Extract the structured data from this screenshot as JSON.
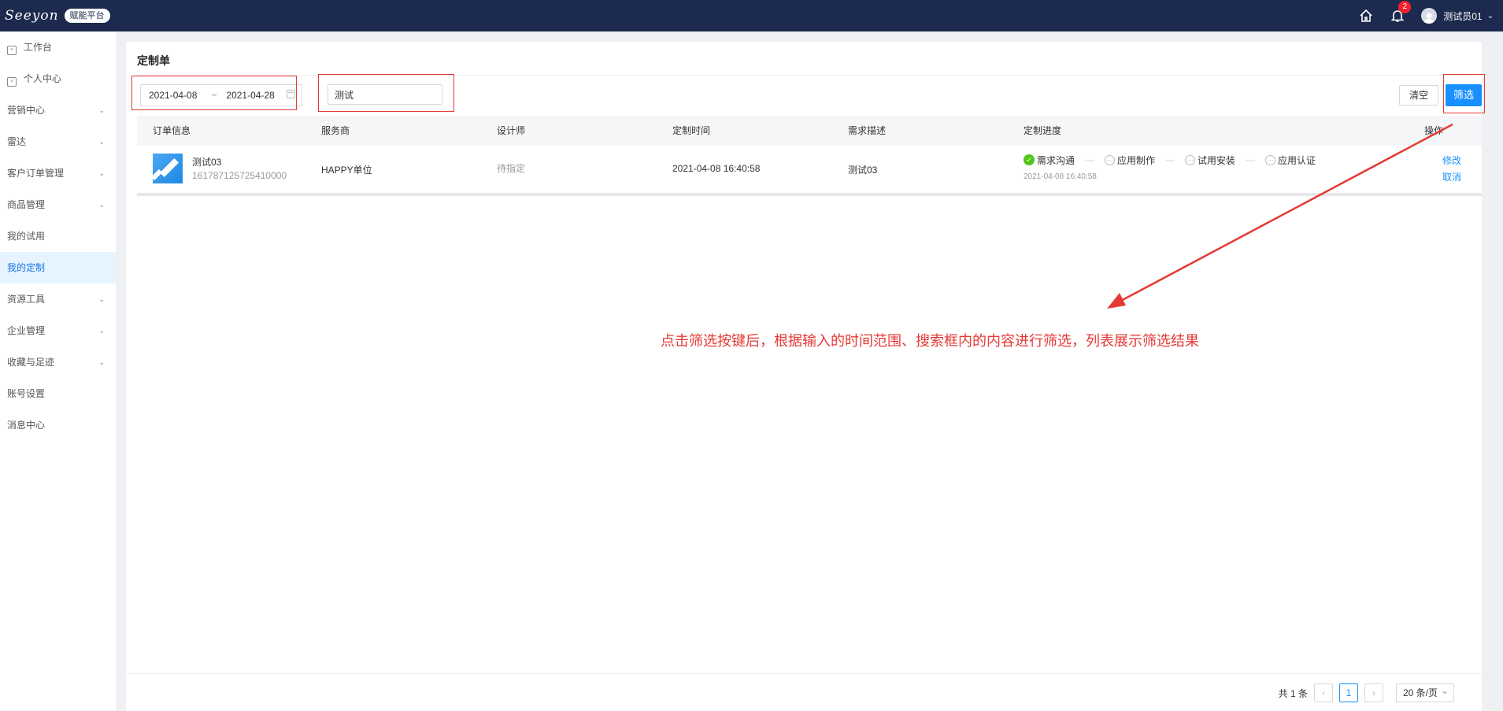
{
  "app": {
    "logo": "Seeyon",
    "badge": "赋能平台"
  },
  "header": {
    "notifications": "2",
    "user": "测试员01"
  },
  "sidebar": {
    "items": [
      {
        "label": "工作台",
        "icon": true,
        "arrow": false
      },
      {
        "label": "个人中心",
        "icon": true,
        "arrow": false
      },
      {
        "label": "营销中心",
        "icon": false,
        "arrow": true
      },
      {
        "label": "雷达",
        "icon": false,
        "arrow": true
      },
      {
        "label": "客户订单管理",
        "icon": false,
        "arrow": true
      },
      {
        "label": "商品管理",
        "icon": false,
        "arrow": true
      },
      {
        "label": "我的试用",
        "icon": false,
        "arrow": false
      },
      {
        "label": "我的定制",
        "icon": false,
        "arrow": false,
        "active": true
      },
      {
        "label": "资源工具",
        "icon": false,
        "arrow": true
      },
      {
        "label": "企业管理",
        "icon": false,
        "arrow": true
      },
      {
        "label": "收藏与足迹",
        "icon": false,
        "arrow": true
      },
      {
        "label": "账号设置",
        "icon": false,
        "arrow": false
      },
      {
        "label": "消息中心",
        "icon": false,
        "arrow": false
      }
    ]
  },
  "main": {
    "title": "定制单",
    "filter": {
      "start_date": "2021-04-08",
      "separator": "~",
      "end_date": "2021-04-28",
      "search_value": "测试",
      "clear_label": "清空",
      "filter_label": "筛选"
    },
    "table": {
      "columns": [
        "订单信息",
        "服务商",
        "设计师",
        "定制时间",
        "需求描述",
        "定制进度",
        "操作"
      ],
      "rows": [
        {
          "name": "测试03",
          "order_no": "161787125725410000",
          "provider": "HAPPY单位",
          "designer": "待指定",
          "time": "2021-04-08 16:40:58",
          "desc": "测试03",
          "progress": {
            "steps": [
              "需求沟通",
              "应用制作",
              "试用安装",
              "应用认证"
            ],
            "done_index": 0,
            "date": "2021-04-08 16:40:58"
          },
          "actions": [
            "修改",
            "取消"
          ]
        }
      ]
    }
  },
  "annotation": "点击筛选按键后，根据输入的时间范围、搜索框内的内容进行筛选，列表展示筛选结果",
  "pagination": {
    "total_text": "共 1 条",
    "current_page": "1",
    "page_size": "20 条/页"
  },
  "colors": {
    "topbar": "#1d2a4f",
    "primary": "#1890ff",
    "annotation": "#e53935",
    "done": "#52c41a"
  }
}
